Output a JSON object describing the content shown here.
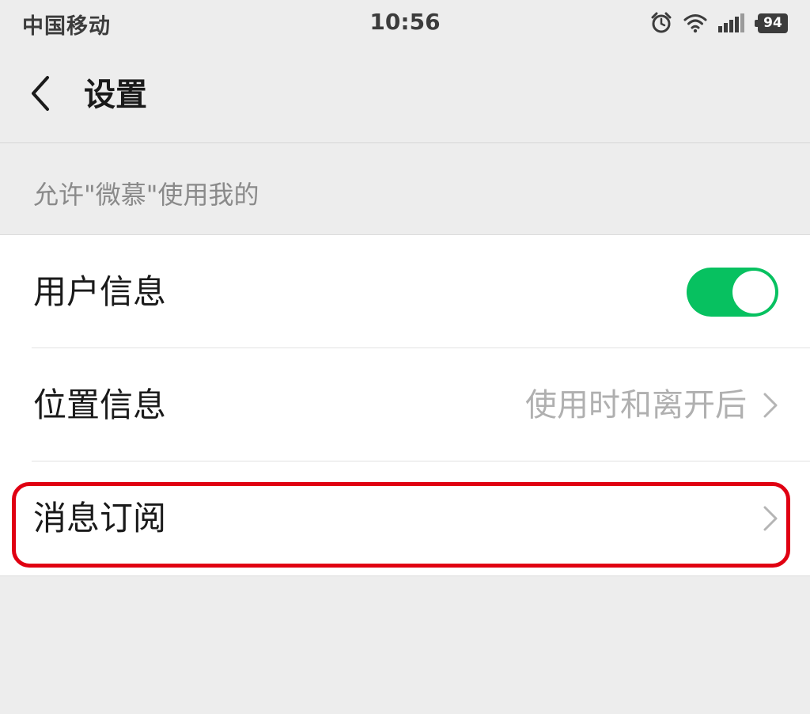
{
  "status_bar": {
    "carrier": "中国移动",
    "time": "10:56",
    "battery": "94",
    "icons": [
      "alarm-icon",
      "wifi-icon",
      "signal-icon",
      "battery-icon"
    ]
  },
  "nav": {
    "back_icon": "chevron-left-icon",
    "title": "设置"
  },
  "section": {
    "header": "允许\"微慕\"使用我的"
  },
  "settings": {
    "items": [
      {
        "label": "用户信息",
        "control": "toggle",
        "enabled": true
      },
      {
        "label": "位置信息",
        "value": "使用时和离开后",
        "control": "chevron"
      },
      {
        "label": "消息订阅",
        "control": "chevron"
      }
    ]
  },
  "colors": {
    "background": "#ededed",
    "toggle_on": "#07c160",
    "highlight": "#e00012"
  }
}
